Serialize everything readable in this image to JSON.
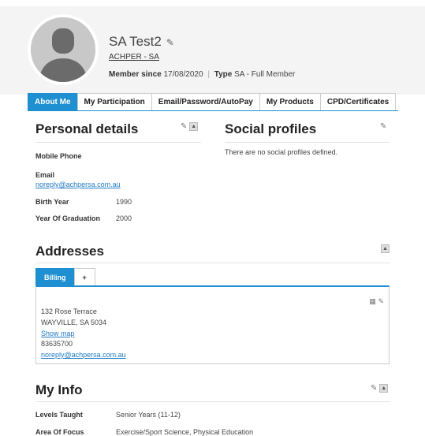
{
  "header": {
    "cutoff_text": "",
    "name": "SA Test2",
    "org": "ACHPER - SA",
    "member_since_label": "Member since",
    "member_since": "17/08/2020",
    "type_label": "Type",
    "type": "SA - Full Member"
  },
  "tabs": [
    "About Me",
    "My Participation",
    "Email/Password/AutoPay",
    "My Products",
    "CPD/Certificates"
  ],
  "personal": {
    "title": "Personal details",
    "mobile_label": "Mobile Phone",
    "email_label": "Email",
    "email": "noreply@achpersa.com.au",
    "birth_label": "Birth Year",
    "birth": "1990",
    "grad_label": "Year Of Graduation",
    "grad": "2000"
  },
  "social": {
    "title": "Social profiles",
    "empty": "There are no social profiles defined."
  },
  "addresses": {
    "title": "Addresses",
    "tab_billing": "Billing",
    "tab_add": "+",
    "street": "132 Rose Terrace",
    "city": "WAYVILLE, SA 5034",
    "show_map": "Show map",
    "phone": "83635700",
    "email": "noreply@achpersa.com.au"
  },
  "myinfo": {
    "title": "My Info",
    "levels_label": "Levels Taught",
    "levels": "Senior Years (11-12)",
    "focus_label": "Area Of Focus",
    "focus": "Exercise/Sport Science, Physical Education"
  }
}
